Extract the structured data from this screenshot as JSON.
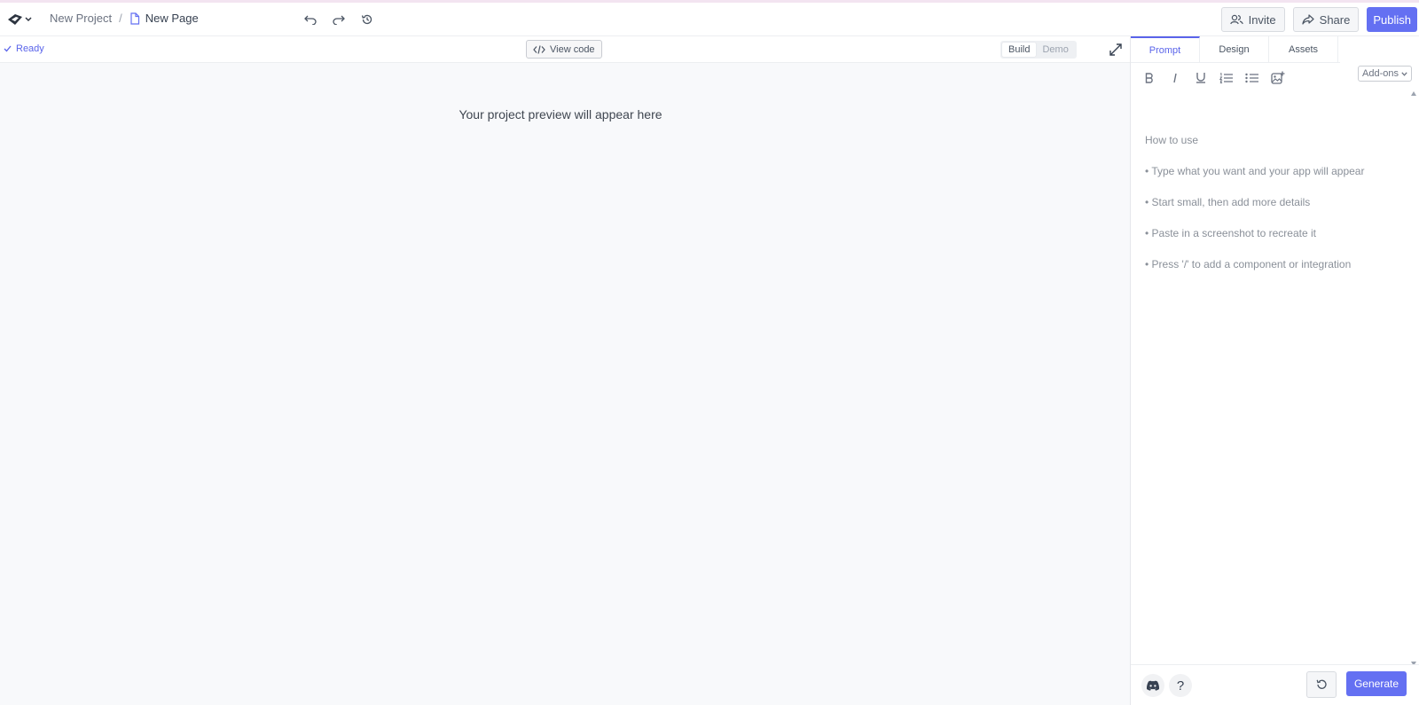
{
  "breadcrumb": {
    "project": "New Project",
    "separator": "/",
    "page": "New Page"
  },
  "header": {
    "invite_label": "Invite",
    "share_label": "Share",
    "publish_label": "Publish"
  },
  "toolbar": {
    "status": "Ready",
    "view_code_label": "View code",
    "mode_build": "Build",
    "mode_demo": "Demo",
    "active_mode": "Build"
  },
  "preview": {
    "placeholder": "Your project preview will appear here"
  },
  "panel": {
    "tabs": [
      {
        "label": "Prompt",
        "active": true
      },
      {
        "label": "Design",
        "active": false
      },
      {
        "label": "Assets",
        "active": false
      }
    ],
    "addons_label": "Add-ons",
    "instructions_heading": "How to use",
    "tips": [
      "• Type what you want and your app will appear",
      "• Start small, then add more details",
      "• Paste in a screenshot to recreate it",
      "• Press '/' to add a component or integration"
    ],
    "help_label": "?",
    "generate_label": "Generate"
  },
  "colors": {
    "accent": "#6470f2",
    "status": "#5a64ea",
    "preview_bg": "#f8f9fb"
  },
  "icons": [
    "logo-icon",
    "chevron-down-icon",
    "file-icon",
    "undo-icon",
    "redo-icon",
    "history-icon",
    "users-icon",
    "share-icon",
    "check-icon",
    "code-icon",
    "expand-icon",
    "bold-icon",
    "italic-icon",
    "underline-icon",
    "ordered-list-icon",
    "bullet-list-icon",
    "image-plus-icon",
    "discord-icon",
    "reset-icon"
  ]
}
